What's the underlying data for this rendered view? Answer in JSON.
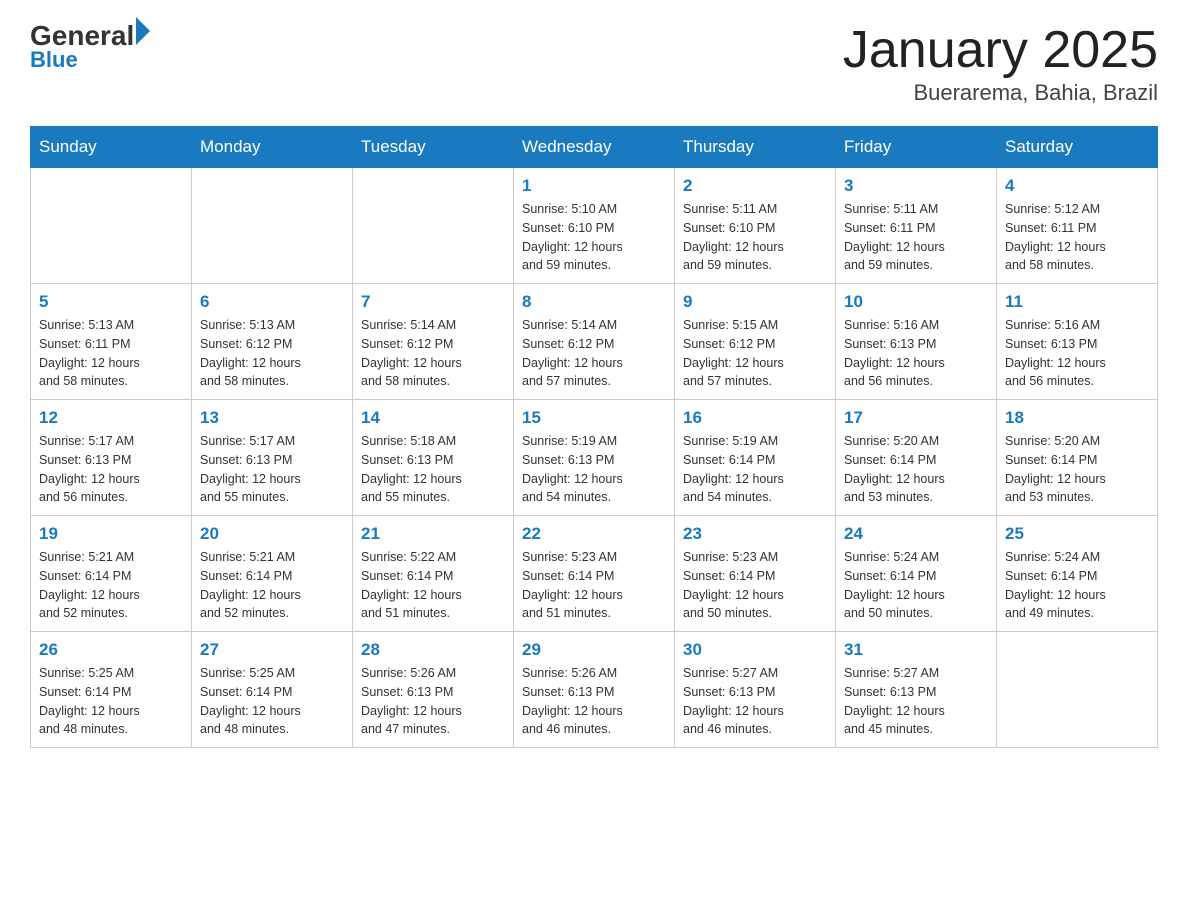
{
  "header": {
    "logo_general": "General",
    "logo_blue": "Blue",
    "month_title": "January 2025",
    "subtitle": "Buerarema, Bahia, Brazil"
  },
  "weekdays": [
    "Sunday",
    "Monday",
    "Tuesday",
    "Wednesday",
    "Thursday",
    "Friday",
    "Saturday"
  ],
  "weeks": [
    [
      {
        "day": "",
        "info": ""
      },
      {
        "day": "",
        "info": ""
      },
      {
        "day": "",
        "info": ""
      },
      {
        "day": "1",
        "info": "Sunrise: 5:10 AM\nSunset: 6:10 PM\nDaylight: 12 hours\nand 59 minutes."
      },
      {
        "day": "2",
        "info": "Sunrise: 5:11 AM\nSunset: 6:10 PM\nDaylight: 12 hours\nand 59 minutes."
      },
      {
        "day": "3",
        "info": "Sunrise: 5:11 AM\nSunset: 6:11 PM\nDaylight: 12 hours\nand 59 minutes."
      },
      {
        "day": "4",
        "info": "Sunrise: 5:12 AM\nSunset: 6:11 PM\nDaylight: 12 hours\nand 58 minutes."
      }
    ],
    [
      {
        "day": "5",
        "info": "Sunrise: 5:13 AM\nSunset: 6:11 PM\nDaylight: 12 hours\nand 58 minutes."
      },
      {
        "day": "6",
        "info": "Sunrise: 5:13 AM\nSunset: 6:12 PM\nDaylight: 12 hours\nand 58 minutes."
      },
      {
        "day": "7",
        "info": "Sunrise: 5:14 AM\nSunset: 6:12 PM\nDaylight: 12 hours\nand 58 minutes."
      },
      {
        "day": "8",
        "info": "Sunrise: 5:14 AM\nSunset: 6:12 PM\nDaylight: 12 hours\nand 57 minutes."
      },
      {
        "day": "9",
        "info": "Sunrise: 5:15 AM\nSunset: 6:12 PM\nDaylight: 12 hours\nand 57 minutes."
      },
      {
        "day": "10",
        "info": "Sunrise: 5:16 AM\nSunset: 6:13 PM\nDaylight: 12 hours\nand 56 minutes."
      },
      {
        "day": "11",
        "info": "Sunrise: 5:16 AM\nSunset: 6:13 PM\nDaylight: 12 hours\nand 56 minutes."
      }
    ],
    [
      {
        "day": "12",
        "info": "Sunrise: 5:17 AM\nSunset: 6:13 PM\nDaylight: 12 hours\nand 56 minutes."
      },
      {
        "day": "13",
        "info": "Sunrise: 5:17 AM\nSunset: 6:13 PM\nDaylight: 12 hours\nand 55 minutes."
      },
      {
        "day": "14",
        "info": "Sunrise: 5:18 AM\nSunset: 6:13 PM\nDaylight: 12 hours\nand 55 minutes."
      },
      {
        "day": "15",
        "info": "Sunrise: 5:19 AM\nSunset: 6:13 PM\nDaylight: 12 hours\nand 54 minutes."
      },
      {
        "day": "16",
        "info": "Sunrise: 5:19 AM\nSunset: 6:14 PM\nDaylight: 12 hours\nand 54 minutes."
      },
      {
        "day": "17",
        "info": "Sunrise: 5:20 AM\nSunset: 6:14 PM\nDaylight: 12 hours\nand 53 minutes."
      },
      {
        "day": "18",
        "info": "Sunrise: 5:20 AM\nSunset: 6:14 PM\nDaylight: 12 hours\nand 53 minutes."
      }
    ],
    [
      {
        "day": "19",
        "info": "Sunrise: 5:21 AM\nSunset: 6:14 PM\nDaylight: 12 hours\nand 52 minutes."
      },
      {
        "day": "20",
        "info": "Sunrise: 5:21 AM\nSunset: 6:14 PM\nDaylight: 12 hours\nand 52 minutes."
      },
      {
        "day": "21",
        "info": "Sunrise: 5:22 AM\nSunset: 6:14 PM\nDaylight: 12 hours\nand 51 minutes."
      },
      {
        "day": "22",
        "info": "Sunrise: 5:23 AM\nSunset: 6:14 PM\nDaylight: 12 hours\nand 51 minutes."
      },
      {
        "day": "23",
        "info": "Sunrise: 5:23 AM\nSunset: 6:14 PM\nDaylight: 12 hours\nand 50 minutes."
      },
      {
        "day": "24",
        "info": "Sunrise: 5:24 AM\nSunset: 6:14 PM\nDaylight: 12 hours\nand 50 minutes."
      },
      {
        "day": "25",
        "info": "Sunrise: 5:24 AM\nSunset: 6:14 PM\nDaylight: 12 hours\nand 49 minutes."
      }
    ],
    [
      {
        "day": "26",
        "info": "Sunrise: 5:25 AM\nSunset: 6:14 PM\nDaylight: 12 hours\nand 48 minutes."
      },
      {
        "day": "27",
        "info": "Sunrise: 5:25 AM\nSunset: 6:14 PM\nDaylight: 12 hours\nand 48 minutes."
      },
      {
        "day": "28",
        "info": "Sunrise: 5:26 AM\nSunset: 6:13 PM\nDaylight: 12 hours\nand 47 minutes."
      },
      {
        "day": "29",
        "info": "Sunrise: 5:26 AM\nSunset: 6:13 PM\nDaylight: 12 hours\nand 46 minutes."
      },
      {
        "day": "30",
        "info": "Sunrise: 5:27 AM\nSunset: 6:13 PM\nDaylight: 12 hours\nand 46 minutes."
      },
      {
        "day": "31",
        "info": "Sunrise: 5:27 AM\nSunset: 6:13 PM\nDaylight: 12 hours\nand 45 minutes."
      },
      {
        "day": "",
        "info": ""
      }
    ]
  ]
}
